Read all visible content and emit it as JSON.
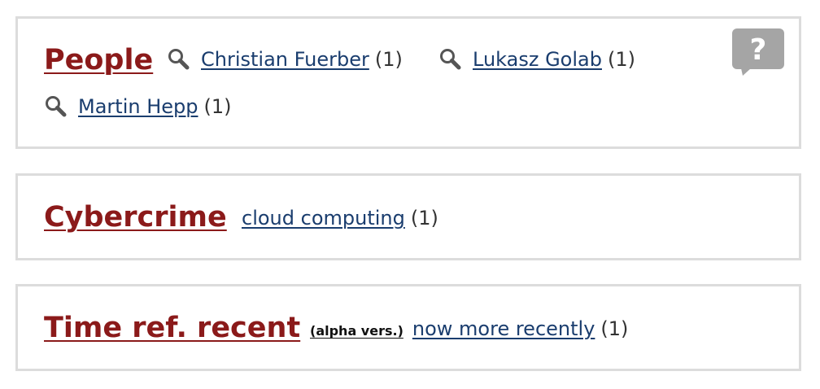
{
  "sections": {
    "people": {
      "heading": "People",
      "items": [
        {
          "label": "Christian Fuerber",
          "count": "(1)"
        },
        {
          "label": "Lukasz Golab",
          "count": "(1)"
        },
        {
          "label": "Martin Hepp",
          "count": "(1)"
        }
      ],
      "help_icon": "help-question-icon",
      "help_label": "?"
    },
    "cybercrime": {
      "heading": "Cybercrime",
      "items": [
        {
          "label": "cloud computing",
          "count": "(1)"
        }
      ]
    },
    "time": {
      "heading": "Time ref. recent",
      "badge": "(alpha vers.)",
      "items": [
        {
          "label": "now more recently",
          "count": "(1)"
        }
      ]
    }
  },
  "colors": {
    "heading": "#8b1a1a",
    "link": "#1a3d6e",
    "border": "#dcdcdc",
    "help_icon": "#a5a5a5"
  },
  "icons": {
    "search": "search-icon"
  }
}
